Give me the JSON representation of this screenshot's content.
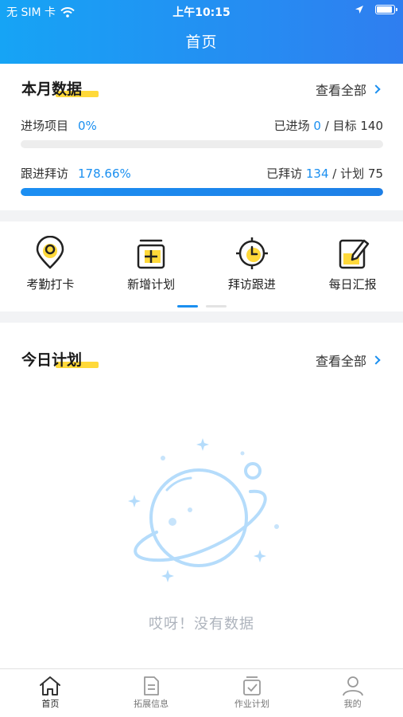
{
  "status_bar": {
    "carrier": "无 SIM 卡",
    "time": "上午10:15"
  },
  "header": {
    "title": "首页"
  },
  "month_card": {
    "title": "本月数据",
    "view_all": "查看全部",
    "entered": {
      "label": "进场项目",
      "percent": "0%",
      "done_label": "已进场",
      "done_value": "0",
      "target_label": "/ 目标",
      "target_value": "140",
      "progress": 0
    },
    "visits": {
      "label": "跟进拜访",
      "percent": "178.66%",
      "done_label": "已拜访",
      "done_value": "134",
      "target_label": "/ 计划",
      "target_value": "75",
      "progress": 1
    }
  },
  "actions": [
    {
      "label": "考勤打卡",
      "icon": "location-pin-icon"
    },
    {
      "label": "新增计划",
      "icon": "add-plan-icon"
    },
    {
      "label": "拜访跟进",
      "icon": "target-clock-icon"
    },
    {
      "label": "每日汇报",
      "icon": "edit-report-icon"
    }
  ],
  "pager": {
    "pages": 2,
    "active": 0
  },
  "today_card": {
    "title": "今日计划",
    "view_all": "查看全部",
    "empty_text": "哎呀！没有数据"
  },
  "tabbar": [
    {
      "label": "首页",
      "icon": "home-icon",
      "active": true
    },
    {
      "label": "拓展信息",
      "icon": "document-icon",
      "active": false
    },
    {
      "label": "作业计划",
      "icon": "checklist-icon",
      "active": false
    },
    {
      "label": "我的",
      "icon": "user-icon",
      "active": false
    }
  ],
  "colors": {
    "primary": "#1a8ff0",
    "accent_yellow": "#ffd93a",
    "header_start": "#16a4f5",
    "header_end": "#2f7ef0"
  }
}
